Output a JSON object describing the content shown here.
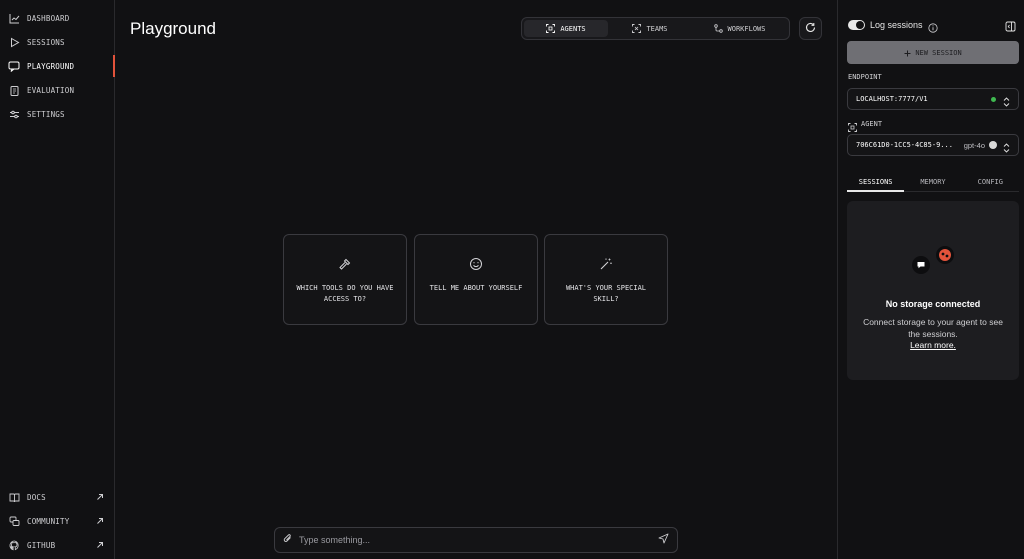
{
  "sidebar": {
    "items": [
      {
        "label": "DASHBOARD",
        "icon": "chart-line-icon"
      },
      {
        "label": "SESSIONS",
        "icon": "play-icon"
      },
      {
        "label": "PLAYGROUND",
        "icon": "chat-bubble-icon",
        "active": true
      },
      {
        "label": "EVALUATION",
        "icon": "clipboard-icon"
      },
      {
        "label": "SETTINGS",
        "icon": "sliders-icon"
      }
    ],
    "footer": [
      {
        "label": "DOCS",
        "icon": "book-icon"
      },
      {
        "label": "COMMUNITY",
        "icon": "community-icon"
      },
      {
        "label": "GITHUB",
        "icon": "github-icon"
      }
    ]
  },
  "main": {
    "title": "Playground",
    "modes": [
      {
        "label": "AGENTS",
        "active": true
      },
      {
        "label": "TEAMS"
      },
      {
        "label": "WORKFLOWS"
      }
    ],
    "prompts": [
      {
        "text": "WHICH TOOLS DO YOU HAVE ACCESS TO?",
        "icon": "hammer-icon"
      },
      {
        "text": "TELL ME ABOUT YOURSELF",
        "icon": "smiley-icon"
      },
      {
        "text": "WHAT'S YOUR SPECIAL SKILL?",
        "icon": "magic-wand-icon"
      }
    ],
    "input_placeholder": "Type something..."
  },
  "panel": {
    "log_sessions_label": "Log sessions",
    "log_sessions_on": true,
    "new_session_label": "NEW SESSION",
    "endpoint_label": "ENDPOINT",
    "endpoint_value": "LOCALHOST:7777/V1",
    "agent_label": "AGENT",
    "agent_value": "706C61D0-1CC5-4C85-9...",
    "agent_model": "gpt-4o",
    "tabs": [
      {
        "label": "SESSIONS",
        "active": true
      },
      {
        "label": "MEMORY"
      },
      {
        "label": "CONFIG"
      }
    ],
    "storage": {
      "title": "No storage connected",
      "description": "Connect storage to your agent to see the sessions.",
      "link": "Learn more."
    }
  },
  "colors": {
    "background": "#111113",
    "accent": "#e2533b",
    "status_green": "#3fb950",
    "border": "#3a3a3f"
  }
}
